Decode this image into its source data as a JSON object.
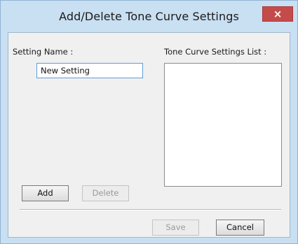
{
  "window": {
    "title": "Add/Delete Tone Curve Settings",
    "close_label": "×"
  },
  "form": {
    "setting_name_label": "Setting Name :",
    "setting_name_value": "New Setting",
    "list_label": "Tone Curve Settings List :",
    "list_items": []
  },
  "buttons": {
    "add_label": "Add",
    "delete_label": "Delete",
    "save_label": "Save",
    "cancel_label": "Cancel"
  },
  "colors": {
    "titlebar": "#c9dff2",
    "close_button": "#c54b4b",
    "dialog_background": "#f0f0f0"
  }
}
